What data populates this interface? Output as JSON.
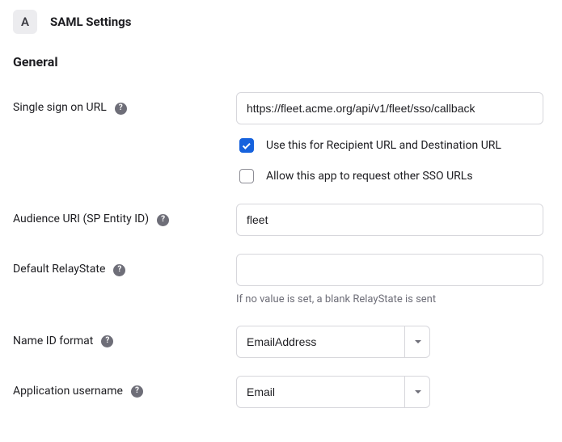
{
  "header": {
    "app_letter": "A",
    "title": "SAML Settings"
  },
  "section_title": "General",
  "fields": {
    "sso_url": {
      "label": "Single sign on URL",
      "value": "https://fleet.acme.org/api/v1/fleet/sso/callback"
    },
    "audience_uri": {
      "label": "Audience URI (SP Entity ID)",
      "value": "fleet"
    },
    "relay_state": {
      "label": "Default RelayState",
      "value": "",
      "hint": "If no value is set, a blank RelayState is sent"
    },
    "name_id_format": {
      "label": "Name ID format",
      "value": "EmailAddress"
    },
    "app_username": {
      "label": "Application username",
      "value": "Email"
    }
  },
  "checkboxes": {
    "use_for_recipient_dest": {
      "label": "Use this for Recipient URL and Destination URL",
      "checked": true
    },
    "allow_other_sso_urls": {
      "label": "Allow this app to request other SSO URLs",
      "checked": false
    }
  }
}
